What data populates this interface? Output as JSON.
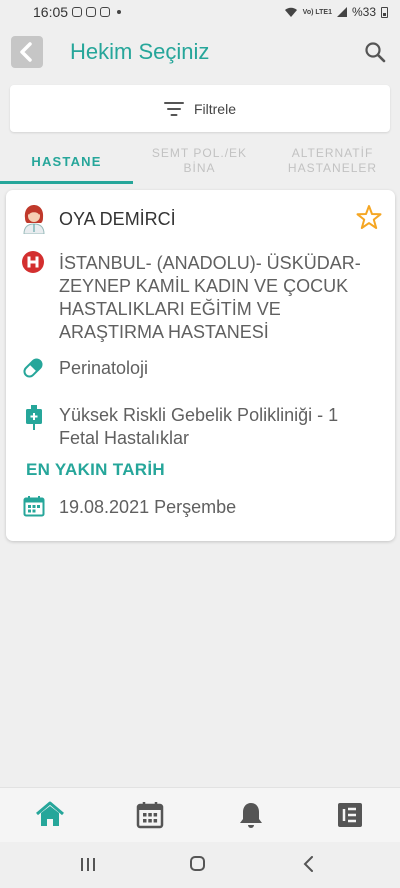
{
  "status_bar": {
    "time": "16:05",
    "network": "Vo) LTE1",
    "battery": "%33"
  },
  "header": {
    "title": "Hekim Seçiniz"
  },
  "filter": {
    "label": "Filtrele"
  },
  "tabs": [
    {
      "label": "HASTANE",
      "active": true
    },
    {
      "label": "SEMT POL./EK BİNA",
      "active": false
    },
    {
      "label": "ALTERNATİF HASTANELER",
      "active": false
    }
  ],
  "doctor_card": {
    "name": "OYA DEMİRCİ",
    "hospital": "İSTANBUL- (ANADOLU)- ÜSKÜDAR-ZEYNEP KAMİL KADIN VE ÇOCUK HASTALIKLARI EĞİTİM VE ARAŞTIRMA HASTANESİ",
    "branch": "Perinatoloji",
    "clinic": "Yüksek Riskli Gebelik Polikliniği - 1 Fetal Hastalıklar",
    "nearest_label": "EN YAKIN TARİH",
    "nearest_date": "19.08.2021 Perşembe"
  },
  "colors": {
    "accent": "#26a69a",
    "hospital_red": "#d32f2f",
    "star": "#f5a623"
  },
  "icons": {
    "back": "back-arrow-icon",
    "search": "search-icon",
    "filter": "filter-icon",
    "doctor": "doctor-avatar-icon",
    "favorite": "star-outline-icon",
    "hospital": "hospital-h-icon",
    "branch": "pill-icon",
    "clinic": "clinic-icon",
    "date": "calendar-icon",
    "nav": [
      "home-icon",
      "calendar-icon",
      "bell-icon",
      "list-icon"
    ]
  }
}
